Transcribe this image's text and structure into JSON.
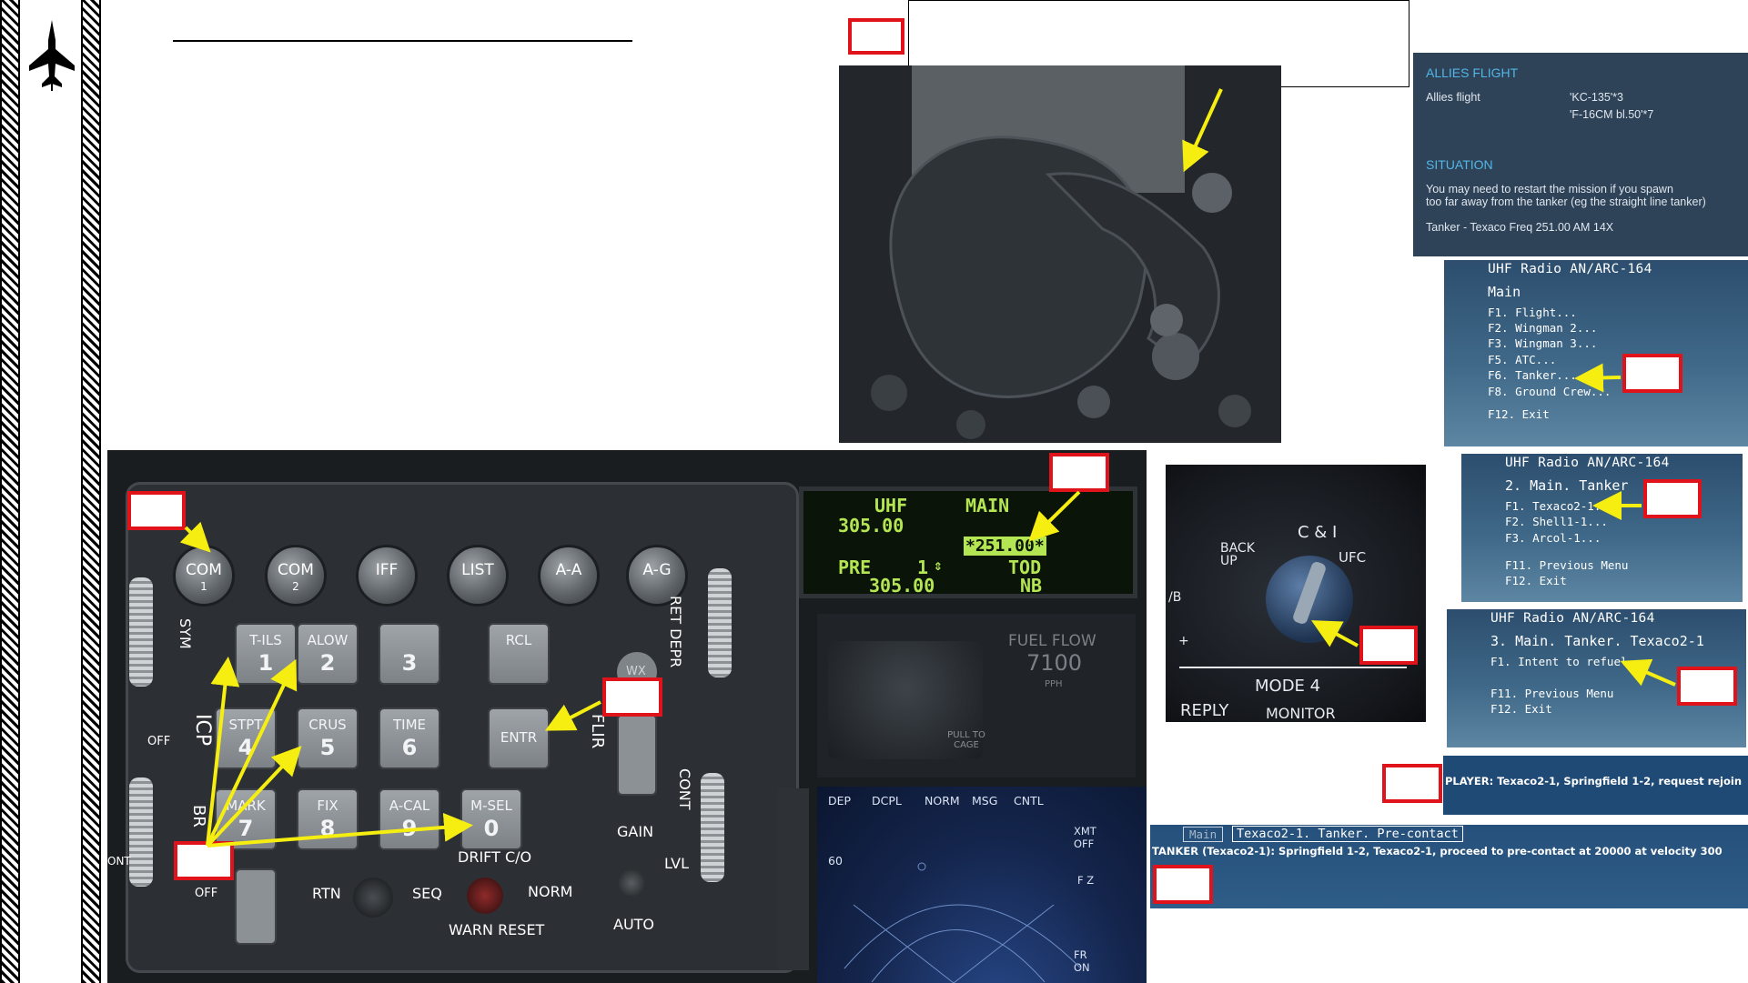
{
  "briefing": {
    "allies_flight_heading": "ALLIES FLIGHT",
    "allies_flight_label": "Allies flight",
    "allies_flight_line1": "'KC-135'*3",
    "allies_flight_line2": "'F-16CM bl.50'*7",
    "situation_heading": "SITUATION",
    "situation_line1": "You may need to restart the mission if you spawn",
    "situation_line2": "too far away from the tanker (eg the straight line tanker)",
    "situation_line3": "Tanker - Texaco Freq 251.00 AM 14X"
  },
  "radio_menu_1": {
    "title": "UHF Radio AN/ARC-164",
    "header": "Main",
    "items": [
      "F1. Flight...",
      "F2. Wingman 2...",
      "F3. Wingman 3...",
      "F5. ATC...",
      "F6. Tanker...",
      "F8. Ground Crew..."
    ],
    "exit": "F12. Exit"
  },
  "radio_menu_2": {
    "title": "UHF Radio AN/ARC-164",
    "header": "2. Main. Tanker",
    "items": [
      "F1. Texaco2-1...",
      "F2. Shell1-1...",
      "F3. Arcol-1..."
    ],
    "prev": "F11. Previous Menu",
    "exit": "F12. Exit"
  },
  "radio_menu_3": {
    "title": "UHF Radio AN/ARC-164",
    "header": "3. Main. Tanker. Texaco2-1",
    "items": [
      "F1. Intent to refuel"
    ],
    "prev": "F11. Previous Menu",
    "exit": "F12. Exit"
  },
  "chat": {
    "player_message": "PLAYER: Texaco2-1, Springfield 1-2, request rejoin"
  },
  "bottom_menu": {
    "tab_main": "Main",
    "breadcrumb": "Texaco2-1. Tanker. Pre-contact",
    "message": "TANKER (Texaco2-1): Springfield 1-2, Texaco2-1, proceed to pre-contact at 20000 at velocity 300"
  },
  "icp": {
    "top_buttons": [
      {
        "label": "COM",
        "sub": "1"
      },
      {
        "label": "COM",
        "sub": "2"
      },
      {
        "label": "IFF",
        "sub": ""
      },
      {
        "label": "LIST",
        "sub": ""
      },
      {
        "label": "A-A",
        "sub": ""
      },
      {
        "label": "A-G",
        "sub": ""
      }
    ],
    "keys": [
      {
        "top": "T-ILS",
        "num": "1"
      },
      {
        "top": "ALOW",
        "num": "2"
      },
      {
        "top": "",
        "num": "3"
      },
      {
        "top": "RCL",
        "num": ""
      },
      {
        "top": "STPT",
        "num": "4"
      },
      {
        "top": "CRUS",
        "num": "5"
      },
      {
        "top": "TIME",
        "num": "6"
      },
      {
        "top": "ENTR",
        "num": ""
      },
      {
        "top": "MARK",
        "num": "7"
      },
      {
        "top": "FIX",
        "num": "8"
      },
      {
        "top": "A-CAL",
        "num": "9"
      },
      {
        "top": "M-SEL",
        "num": "0"
      }
    ],
    "labels": {
      "sym": "SYM",
      "icp": "ICP",
      "br": "BR",
      "off_left": "OFF",
      "off_bottom": "OFF",
      "ret_depr": "RET DEPR",
      "flir": "FLIR",
      "cont": "CONT",
      "wx": "WX",
      "gain": "GAIN",
      "lvl": "LVL",
      "auto": "AUTO",
      "drift": "DRIFT C/O",
      "rtn": "RTN",
      "seq": "SEQ",
      "norm": "NORM",
      "warn_reset": "WARN RESET",
      "ont": "ONT"
    }
  },
  "ded": {
    "uhf": "UHF",
    "main": "MAIN",
    "freq_top": "305.00",
    "selected_freq": "*251.00*",
    "pre": "PRE",
    "preset_num": "1",
    "preset_arrows": "⇕",
    "tod": "TOD",
    "freq_bottom": "305.00",
    "nb": "NB"
  },
  "instruments": {
    "fuel_flow_label": "FUEL FLOW",
    "fuel_flow_value": "7100",
    "fuel_flow_unit": "PPH",
    "pull_to_cage": "PULL TO CAGE"
  },
  "mfd": {
    "tabs": [
      "DEP",
      "DCPL",
      "NORM",
      "MSG",
      "CNTL"
    ],
    "range": "60",
    "xmt": "XMT OFF",
    "fz": "F Z",
    "fr_on": "FR ON"
  },
  "mode_knob": {
    "top_label": "C & I",
    "backup": "BACK UP",
    "ufc": "UFC",
    "mode4": "MODE 4",
    "reply": "REPLY",
    "monitor": "MONITOR",
    "left_b": "/B",
    "plus": "+"
  },
  "colors": {
    "callout_red": "#e0131a",
    "arrow_yellow": "#f5ee10",
    "radio_bg": "#3f6888",
    "briefing_bg": "#2e4258",
    "briefing_heading": "#52b7e8",
    "ded_green": "#b4e654"
  }
}
